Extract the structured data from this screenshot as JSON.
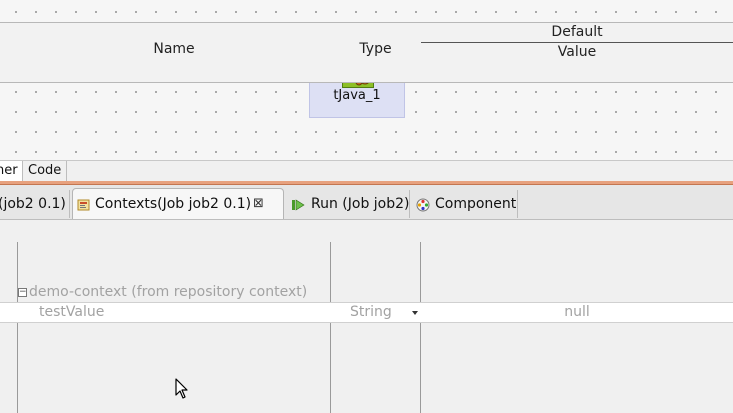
{
  "canvas": {
    "component_label": "tJava_1"
  },
  "editor_tabs": {
    "designer": "ner",
    "code": "Code"
  },
  "view_tabs": {
    "job": "(job2 0.1)",
    "contexts": "Contexts(Job job2 0.1)",
    "run": "Run (Job job2)",
    "component": "Component"
  },
  "table": {
    "columns": {
      "name": "Name",
      "type": "Type",
      "default": "Default",
      "value": "Value"
    },
    "group": {
      "expander": "−",
      "name": "demo-context (from repository context)"
    },
    "rows": [
      {
        "name": "testValue",
        "type": "String",
        "value": "null"
      }
    ]
  },
  "colors": {
    "component_bg": "#dde0f4",
    "separator": "#e7a17e",
    "placeholder_text": "#a2a2a2"
  },
  "icons": [
    "java-component-icon",
    "contexts-icon",
    "close-icon",
    "run-icon",
    "component-icon",
    "mouse-cursor"
  ]
}
